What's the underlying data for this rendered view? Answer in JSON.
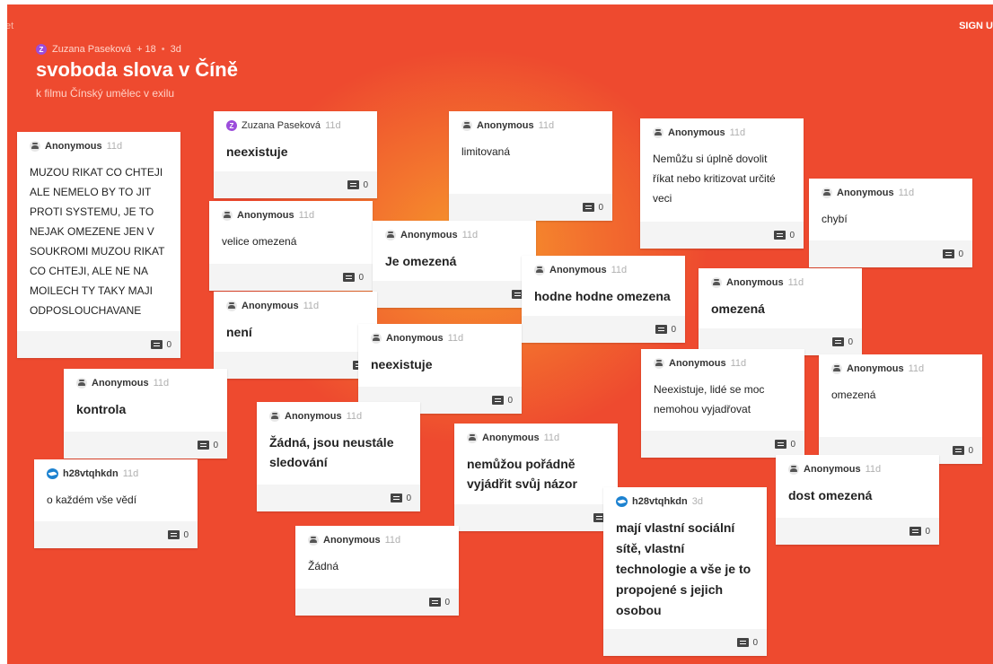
{
  "app": {
    "left_text": "et",
    "signup_label": "SIGN U"
  },
  "board": {
    "author_initial": "Z",
    "author": "Zuzana Paseková",
    "likes": "+ 18",
    "age": "3d",
    "title": "svoboda slova v Číně",
    "subtitle": "k filmu Čínský umělec v exilu"
  },
  "cards": [
    {
      "author": "Anonymous",
      "age": "11d",
      "text": "MUZOU RIKAT CO CHTEJI ALE NEMELO BY TO JIT PROTI SYSTEMU, JE TO NEJAK OMEZENE JEN V SOUKROMI MUZOU RIKAT CO CHTEJI, ALE NE NA MOILECH TY TAKY MAJI ODPOSLOUCHAVANE",
      "comments": "0"
    },
    {
      "author": "Zuzana Paseková",
      "age": "11d",
      "text": "neexistuje",
      "comments": "0"
    },
    {
      "author": "Anonymous",
      "age": "11d",
      "text": "limitovaná",
      "comments": "0"
    },
    {
      "author": "Anonymous",
      "age": "11d",
      "text": "Nemůžu si úplně dovolit říkat nebo kritizovat určité veci",
      "comments": "0"
    },
    {
      "author": "Anonymous",
      "age": "11d",
      "text": "chybí",
      "comments": "0"
    },
    {
      "author": "Anonymous",
      "age": "11d",
      "text": "velice omezená",
      "comments": "0"
    },
    {
      "author": "Anonymous",
      "age": "11d",
      "text": "Je omezená",
      "comments": ""
    },
    {
      "author": "Anonymous",
      "age": "11d",
      "text": "hodne hodne omezena",
      "comments": "0"
    },
    {
      "author": "Anonymous",
      "age": "11d",
      "text": "omezená",
      "comments": "0"
    },
    {
      "author": "Anonymous",
      "age": "11d",
      "text": "není",
      "comments": ""
    },
    {
      "author": "Anonymous",
      "age": "11d",
      "text": "neexistuje",
      "comments": "0"
    },
    {
      "author": "Anonymous",
      "age": "11d",
      "text": "Neexistuje, lidé se moc nemohou vyjadřovat",
      "comments": "0"
    },
    {
      "author": "Anonymous",
      "age": "11d",
      "text": "omezená",
      "comments": "0"
    },
    {
      "author": "Anonymous",
      "age": "11d",
      "text": "kontrola",
      "comments": "0"
    },
    {
      "author": "Anonymous",
      "age": "11d",
      "text": "Žádná, jsou neustále sledování",
      "comments": "0"
    },
    {
      "author": "Anonymous",
      "age": "11d",
      "text": "nemůžou pořádně vyjádřit svůj názor",
      "comments": ""
    },
    {
      "author": "Anonymous",
      "age": "11d",
      "text": "dost omezená",
      "comments": "0"
    },
    {
      "author": "h28vtqhkdn",
      "age": "11d",
      "text": "o každém vše vědí",
      "comments": "0"
    },
    {
      "author": "h28vtqhkdn",
      "age": "3d",
      "text": "mají vlastní sociální sítě, vlastní technologie a vše je to propojené s jejich osobou",
      "comments": "0"
    },
    {
      "author": "Anonymous",
      "age": "11d",
      "text": "Žádná",
      "comments": "0"
    }
  ]
}
